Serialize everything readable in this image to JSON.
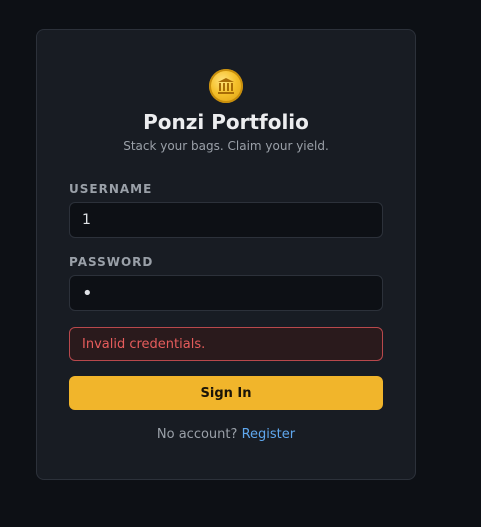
{
  "app": {
    "title": "Ponzi Portfolio",
    "subtitle": "Stack your bags. Claim your yield.",
    "logo_icon": "bank-coin-icon"
  },
  "form": {
    "username_label": "USERNAME",
    "username_value": "1",
    "password_label": "PASSWORD",
    "password_value": "•",
    "error_message": "Invalid credentials.",
    "submit_label": "Sign In",
    "register_prompt": "No account?",
    "register_link": "Register"
  },
  "colors": {
    "background": "#0d1015",
    "card": "#181c23",
    "accent": "#f1b52b",
    "error": "#e65c5c",
    "link": "#5fa7ee"
  }
}
